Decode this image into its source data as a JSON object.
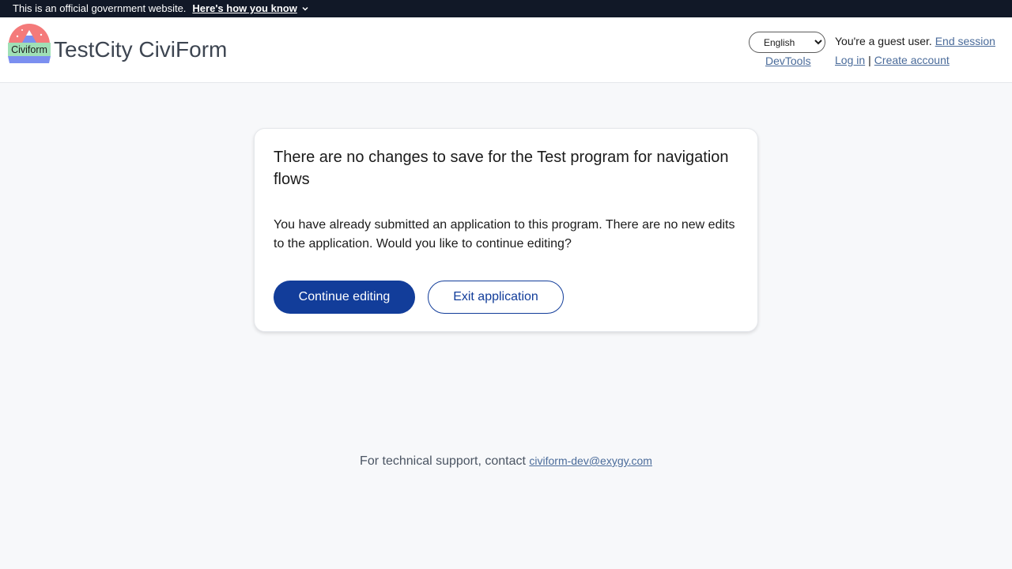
{
  "banner": {
    "official_text": "This is an official government website.",
    "how_label": "Here's how you know"
  },
  "header": {
    "logo_text": "Civiform",
    "site_title": "TestCity CiviForm",
    "language": {
      "selected": "English",
      "options": [
        "English"
      ]
    },
    "devtools_label": "DevTools",
    "guest_text": "You're a guest user.",
    "end_session_label": "End session",
    "login_label": "Log in",
    "separator": "|",
    "create_account_label": "Create account"
  },
  "modal": {
    "title": "There are no changes to save for the Test program for navigation flows",
    "body": "You have already submitted an application to this program. There are no new edits to the application. Would you like to continue editing?",
    "continue_label": "Continue editing",
    "exit_label": "Exit application"
  },
  "footer": {
    "support_text": "For technical support, contact",
    "email": "civiform-dev@exygy.com"
  },
  "colors": {
    "primary": "#123d9a",
    "banner_bg": "#111827",
    "link": "#4a6b9a",
    "page_bg": "#f7f8fa"
  }
}
